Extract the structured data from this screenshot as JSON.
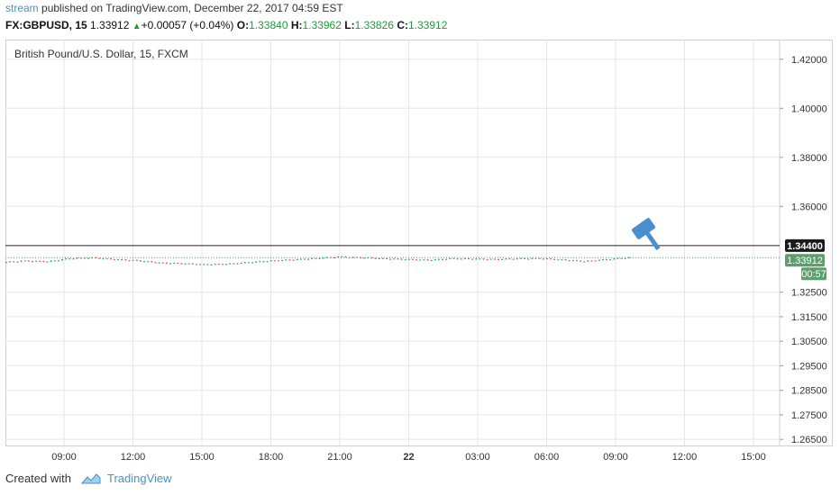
{
  "header": {
    "author": "stream",
    "published_text": " published on TradingView.com, December 22, 2017 04:59 EST"
  },
  "quote": {
    "symbol": "FX:GBPUSD, 15",
    "last": "1.33912",
    "change_arrow": "▲",
    "change": "+0.00057 (+0.04%)",
    "open_label": "O:",
    "open": "1.33840",
    "high_label": "H:",
    "high": "1.33962",
    "low_label": "L:",
    "low": "1.33826",
    "close_label": "C:",
    "close": "1.33912"
  },
  "legend": "British Pound/U.S. Dollar, 15, FXCM",
  "footer": {
    "created_with": "Created with",
    "brand": "TradingView"
  },
  "colors": {
    "up": "#26a69a",
    "down": "#ef5350",
    "grid": "#e6e6e6",
    "axis_text": "#333333",
    "price_tag": "#5d9e6e",
    "hline_tag": "#1a1a1a",
    "alert_icon": "#4a8ed0"
  },
  "chart_data": {
    "type": "candlestick",
    "title": "British Pound/U.S. Dollar, 15, FXCM",
    "y_ticks": [
      "1.42000",
      "1.40000",
      "1.38000",
      "1.36000",
      "1.34400",
      "1.33912",
      "1.32500",
      "1.31500",
      "1.30500",
      "1.29500",
      "1.28500",
      "1.27500",
      "1.26500"
    ],
    "y_ticks_plain": [
      "1.42000",
      "1.40000",
      "1.38000",
      "1.36000",
      "1.32500",
      "1.31500",
      "1.30500",
      "1.29500",
      "1.28500",
      "1.27500",
      "1.26500"
    ],
    "x_ticks": [
      "09:00",
      "12:00",
      "15:00",
      "18:00",
      "21:00",
      "22",
      "03:00",
      "06:00",
      "09:00",
      "12:00",
      "15:00"
    ],
    "ylim": [
      1.2625,
      1.428
    ],
    "horizontal_line": {
      "value": 1.344,
      "label": "1.34400"
    },
    "last_price": {
      "value": 1.33912,
      "label": "1.33912",
      "countdown": "00:57"
    },
    "series": [
      {
        "time": "07:15",
        "close": 1.3372
      },
      {
        "time": "08:15",
        "close": 1.3378
      },
      {
        "time": "09:00",
        "close": 1.3375
      },
      {
        "time": "09:30",
        "close": 1.3388
      },
      {
        "time": "10:30",
        "close": 1.339
      },
      {
        "time": "11:30",
        "close": 1.3384
      },
      {
        "time": "12:30",
        "close": 1.3379
      },
      {
        "time": "13:00",
        "close": 1.337
      },
      {
        "time": "14:00",
        "close": 1.3367
      },
      {
        "time": "15:00",
        "close": 1.3363
      },
      {
        "time": "15:30",
        "close": 1.3365
      },
      {
        "time": "16:30",
        "close": 1.3372
      },
      {
        "time": "17:30",
        "close": 1.3378
      },
      {
        "time": "18:30",
        "close": 1.3383
      },
      {
        "time": "19:30",
        "close": 1.3388
      },
      {
        "time": "21:00",
        "close": 1.3395
      },
      {
        "time": "22:00",
        "close": 1.3391
      },
      {
        "time": "23:30",
        "close": 1.3387
      },
      {
        "time": "01:00",
        "close": 1.3384
      },
      {
        "time": "02:00",
        "close": 1.3381
      },
      {
        "time": "03:00",
        "close": 1.3387
      },
      {
        "time": "04:00",
        "close": 1.3386
      },
      {
        "time": "05:00",
        "close": 1.3384
      },
      {
        "time": "06:00",
        "close": 1.3387
      },
      {
        "time": "07:00",
        "close": 1.3388
      },
      {
        "time": "08:00",
        "close": 1.3382
      },
      {
        "time": "08:30",
        "close": 1.3376
      },
      {
        "time": "09:00",
        "close": 1.3384
      },
      {
        "time": "09:30",
        "close": 1.3391
      }
    ]
  }
}
